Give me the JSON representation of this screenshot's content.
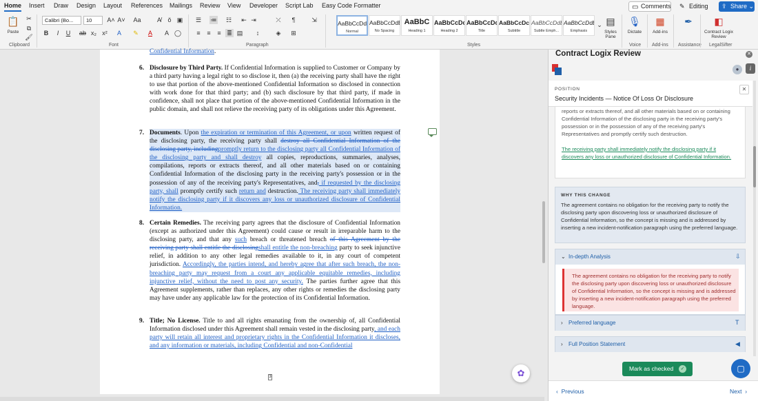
{
  "menu": {
    "tabs": [
      "Home",
      "Insert",
      "Draw",
      "Design",
      "Layout",
      "References",
      "Mailings",
      "Review",
      "View",
      "Developer",
      "Script Lab",
      "Easy Code Formatter"
    ],
    "comments_label": "Comments",
    "editing_label": "Editing",
    "share_label": "Share"
  },
  "ribbon": {
    "paste_label": "Paste",
    "font_name": "Calibri (Bo...",
    "font_size": "10",
    "groups": {
      "clipboard": "Clipboard",
      "font": "Font",
      "paragraph": "Paragraph",
      "styles": "Styles",
      "voice": "Voice",
      "addins": "Add-ins",
      "assistance": "Assistance",
      "legalsifter": "LegalSifter"
    },
    "styles": [
      {
        "preview": "AaBbCcDdEe",
        "name": "Normal"
      },
      {
        "preview": "AaBbCcDdEe",
        "name": "No Spacing"
      },
      {
        "preview": "AaBbC",
        "name": "Heading 1"
      },
      {
        "preview": "AaBbCcDc",
        "name": "Heading 2"
      },
      {
        "preview": "AaBbCcDc",
        "name": "Title"
      },
      {
        "preview": "AaBbCcDc",
        "name": "Subtitle"
      },
      {
        "preview": "AaBbCcDdEe",
        "name": "Subtle Emph..."
      },
      {
        "preview": "AaBbCcDdEe",
        "name": "Emphasis"
      }
    ],
    "styles_pane_label": "Styles Pane",
    "dictate_label": "Dictate",
    "addins_label": "Add-ins",
    "contract_logix_label": "Contract Logix Review"
  },
  "document": {
    "top_fragment": "Confidential Information",
    "para6": {
      "num": "6.",
      "heading": "Disclosure by Third Party.",
      "text": " If Confidential Information is supplied to Customer or Company by a third party having a legal right to so disclose it, then (a) the receiving party shall have the right to use that portion of the above-mentioned Confidential Information so disclosed in connection with work done for that third party; and (b) such disclosure by that third party, if made in confidence, shall not place that portion of the above-mentioned Confidential Information in the public domain, and shall not relieve the receiving party of its obligations under this Agreement."
    },
    "para7": {
      "num": "7.",
      "heading": "Documents",
      "t1": ". Upon ",
      "ins1": "the expiration or termination of this Agreement, or upon",
      "t2": " written request of the disclosing party, the receiving party shall ",
      "del1": "destroy all Confidential Information of the disclosing party, including",
      "ins2": "promptly return to the disclosing party all Confidential Information of the disclosing party and shall destroy",
      "t3": " all copies, reproductions, summaries, analyses, compilations, reports or extracts thereof, and all other materials based on or containing Confidential Information of the disclosing party in the receiving party's possession or in the possession of any of the receiving party's Representatives, and",
      "del2": ",",
      "ins3": " if requested by the disclosing party, shall",
      "t4": " promptly certify such ",
      "ins4": "return and",
      "t5": " destruction.",
      "ins5": "  The receiving party shall immediately notify the disclosing party if it discovers any loss or unauthorized disclosure of Confidential Information."
    },
    "para8": {
      "num": "8.",
      "heading": "Certain Remedies.",
      "t1": " The receiving party agrees that the disclosure of Confidential Information (except as authorized under this Agreement) could cause or result in irreparable harm to the disclosing party, and that any ",
      "ins1": "such",
      "t2": " breach or threatened breach ",
      "del1": "of this Agreement by the receiving party shall entitle the disclosing",
      "ins2": "shall entitle the non-breaching",
      "t3": " party to seek injunctive relief, in addition to any other legal remedies available to it, in any court of competent jurisdiction. ",
      "ins3": "Accordingly, the parties intend, and hereby agree that after such breach, the non-breaching party may request from a court any applicable equitable remedies, including injunctive relief, without the need to post any security.",
      "t4": " The parties further agree that this Agreement supplements, rather than replaces, any other rights or remedies the disclosing party may have under any applicable law for the protection of its Confidential Information."
    },
    "para9": {
      "num": "9.",
      "heading": "Title; No License.",
      "t1": " Title to and all rights emanating from the ownership of, all Confidential Information disclosed under this Agreement shall remain vested in the disclosing party",
      "ins1": ", and each party will retain all interest and proprietary rights in the Confidential Information it discloses, and any information or materials, including Confidential and non-Confidential"
    },
    "page_marker": "3"
  },
  "panel": {
    "title": "Contract Logix Review",
    "position_label": "POSITION",
    "position_value": "Security Incidents — Notice Of Loss Or Disclosure",
    "clause_text": "reports or extracts thereof, and all other materials based on or containing Confidential Information of the disclosing party in the receiving party's possession or in the possession of any of the receiving party's Representatives and promptly certify such destruction.",
    "clause_inserted": "The receiving party shall immediately notify the disclosing party if it discovers any loss or unauthorized disclosure of Confidential Information.",
    "why_label": "WHY THIS CHANGE",
    "why_text": "The agreement contains no obligation for the receiving party to notify the disclosing party upon discovering loss or unauthorized disclosure of Confidential Information, so the concept is missing and is addressed by inserting a new incident-notification paragraph using the preferred language.",
    "analysis_title": "In-depth Analysis",
    "analysis_text": "The agreement contains no obligation for the receiving party to notify the disclosing party upon discovering loss or unauthorized disclosure of Confidential Information, so the concept is missing and is addressed by inserting a new incident-notification paragraph using the preferred language.",
    "preferred_title": "Preferred language",
    "full_position_title": "Full Position Statement",
    "mark_checked_label": "Mark as checked",
    "previous_label": "Previous",
    "next_label": "Next"
  },
  "colors": {
    "accent": "#1f6bc5",
    "revision": "#1f5fc5",
    "success": "#1b8a5a",
    "danger": "#d33"
  }
}
